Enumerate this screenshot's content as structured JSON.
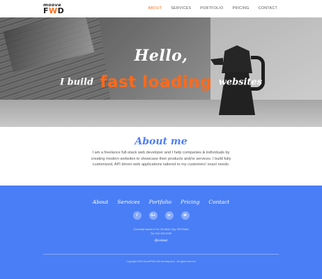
{
  "nav": {
    "logo_top": "moove",
    "logo_bottom_a": "F",
    "logo_bottom_b": "W",
    "logo_bottom_c": "D",
    "items": [
      {
        "label": "ABOUT",
        "active": true
      },
      {
        "label": "SERVICES",
        "active": false
      },
      {
        "label": "PORTFOLIO",
        "active": false
      },
      {
        "label": "PRICING",
        "active": false
      },
      {
        "label": "CONTACT",
        "active": false
      }
    ]
  },
  "hero": {
    "greeting": "Hello,",
    "line_prefix": "I build",
    "line_highlight": "fast loading",
    "line_suffix": "websites"
  },
  "about": {
    "title": "About me",
    "text": "I am a freelance full-stack web developer and I help companies & individuals by creating modern websites to showcase their products and/or services. I build fully customized, API driven web applications tailored to my customers' exact needs."
  },
  "footer": {
    "links": [
      "About",
      "Services",
      "Portfolio",
      "Pricing",
      "Contact"
    ],
    "socials": [
      {
        "icon": "facebook-icon",
        "glyph": "f"
      },
      {
        "icon": "google-plus-icon",
        "glyph": "G+"
      },
      {
        "icon": "linkedin-icon",
        "glyph": "in"
      },
      {
        "icon": "email-icon",
        "glyph": "✉"
      }
    ],
    "address_line1": "Currently based in Ho Chi Minh City, VIETNAM",
    "address_line2": "Tel: 012 345 6789",
    "contact_link": "@contact",
    "copyright": "Copyright 2018 MooveFWD web development · All rights reserved"
  },
  "colors": {
    "accent": "#ff6a1a",
    "brand_blue": "#4a7ef6"
  }
}
